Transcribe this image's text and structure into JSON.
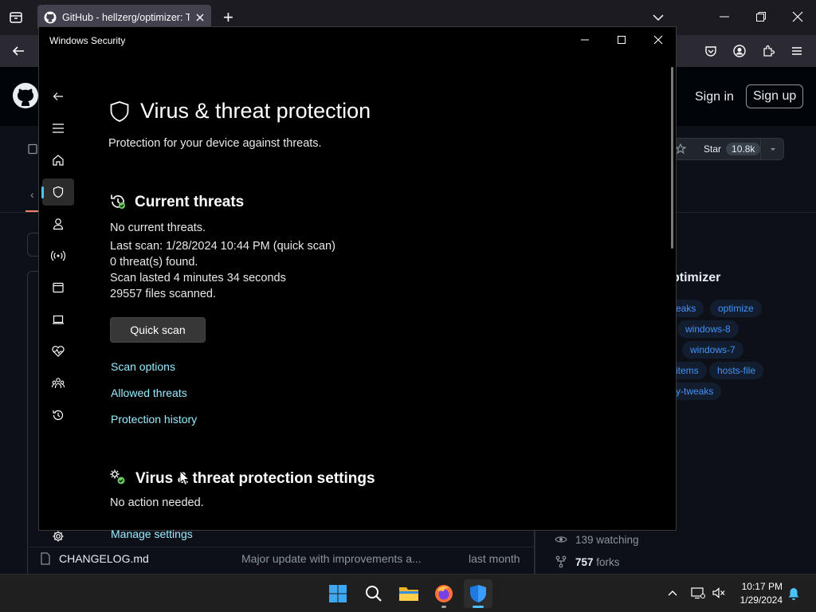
{
  "browser": {
    "tab_title": "GitHub - hellzerg/optimizer: Th",
    "new_tab": "+"
  },
  "github": {
    "sign_in": "Sign in",
    "sign_up": "Sign up",
    "star_label": "Star",
    "star_count": "10.8k",
    "about_title": "ptimizer",
    "topics": [
      "eaks",
      "optimize",
      "windows-8",
      "windows-7",
      "items",
      "hosts-file",
      "y-tweaks"
    ],
    "file_name": "CHANGELOG.md",
    "commit_message": "Major update with improvements a...",
    "commit_time": "last month",
    "watching": "139 watching",
    "forks_count": "757",
    "forks_label": "forks"
  },
  "security": {
    "window_title": "Windows Security",
    "page_title": "Virus & threat protection",
    "page_subtitle": "Protection for your device against threats.",
    "current_threats_heading": "Current threats",
    "threat_lines": [
      "No current threats.",
      "Last scan: 1/28/2024 10:44 PM (quick scan)",
      "0 threat(s) found.",
      "Scan lasted 4 minutes 34 seconds",
      "29557 files scanned."
    ],
    "quick_scan": "Quick scan",
    "links": [
      "Scan options",
      "Allowed threats",
      "Protection history"
    ],
    "settings_heading": "Virus & threat protection settings",
    "settings_status": "No action needed.",
    "manage_settings": "Manage settings"
  },
  "taskbar": {
    "time": "10:17 PM",
    "date": "1/29/2024"
  },
  "colors": {
    "link": "#99ebff",
    "accent": "#4cc2ff",
    "ok_green": "#6ccb5f"
  }
}
